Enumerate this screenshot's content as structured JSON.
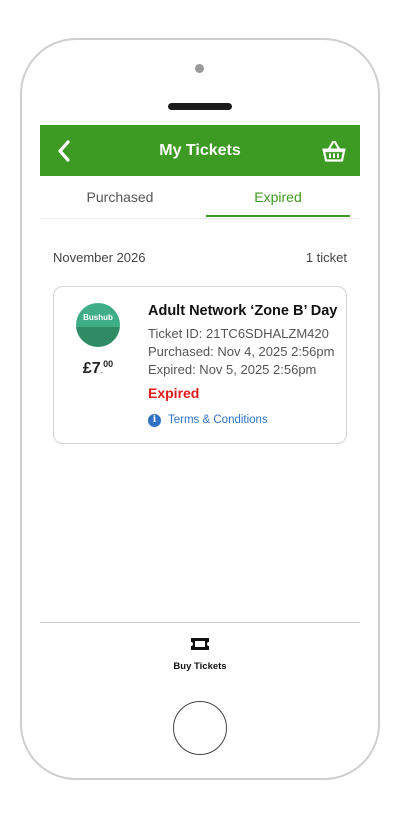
{
  "header": {
    "title": "My Tickets",
    "back_icon": "chevron-left-icon",
    "basket_icon": "basket-icon",
    "color": "#3d9a22"
  },
  "tabs": [
    {
      "label": "Purchased",
      "active": false
    },
    {
      "label": "Expired",
      "active": true
    }
  ],
  "section": {
    "month": "November 2026",
    "count": "1 ticket"
  },
  "ticket": {
    "logo_text": "Bushub",
    "price_main": "£7",
    "price_sep": ".",
    "price_pence": "00",
    "name": "Adult Network ‘Zone B’ Day",
    "id_line": "Ticket ID: 21TC6SDHALZM420",
    "purchased_line": "Purchased: Nov 4, 2025 2:56pm",
    "expired_line": "Expired: Nov 5, 2025 2:56pm",
    "status": "Expired",
    "status_color": "#e01b1b",
    "terms_label": "Terms & Conditions",
    "terms_icon": "info-icon"
  },
  "bottom_nav": {
    "icon": "ticket-icon",
    "label": "Buy Tickets"
  }
}
